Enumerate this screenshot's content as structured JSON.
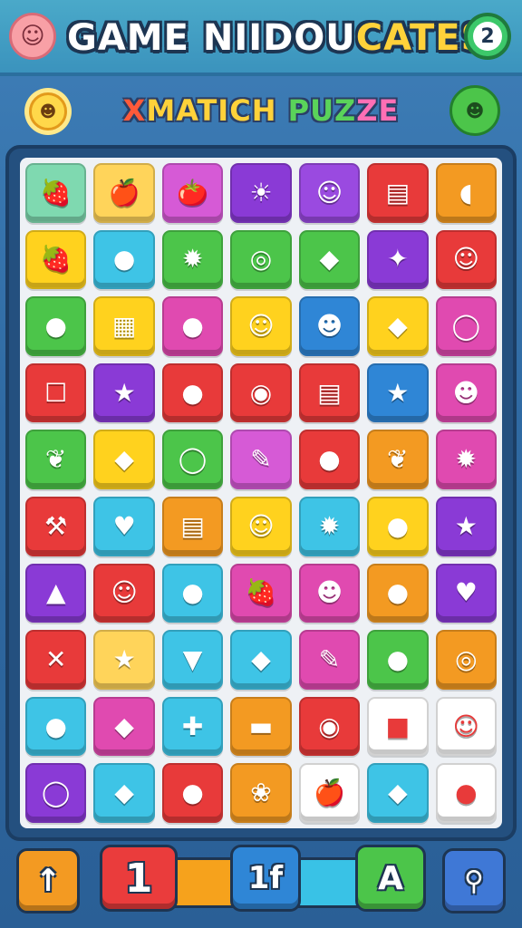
{
  "header": {
    "title_main": "GAME NIIDOU",
    "title_accent": "CATES",
    "level": "2",
    "mascot_icon": "pig-face-icon"
  },
  "subtitle": {
    "parts": [
      "X",
      "MATICH ",
      "PUZ",
      "ZE"
    ],
    "left_icon": "sun-face-icon",
    "right_icon": "green-monster-icon"
  },
  "board": {
    "columns": 7,
    "rows": 10,
    "tiles": [
      {
        "color": "#7fd9b0",
        "icon": "strawberry-icon",
        "glyph": "🍓"
      },
      {
        "color": "#ffd45a",
        "icon": "apple-icon",
        "glyph": "🍎"
      },
      {
        "color": "#d65ad6",
        "icon": "red-fruit-icon",
        "glyph": "🍅"
      },
      {
        "color": "#8a3ad6",
        "icon": "sun-face-icon",
        "glyph": "☀"
      },
      {
        "color": "#9a4ae0",
        "icon": "face-icon",
        "glyph": "☺"
      },
      {
        "color": "#e83a3a",
        "icon": "slot-icon",
        "glyph": "▤"
      },
      {
        "color": "#f39a22",
        "icon": "banana-icon",
        "glyph": "◖"
      },
      {
        "color": "#ffd21e",
        "icon": "berry-face-icon",
        "glyph": "🍓"
      },
      {
        "color": "#3ec4e6",
        "icon": "blue-fruit-icon",
        "glyph": "●"
      },
      {
        "color": "#4cc54a",
        "icon": "green-monster-icon",
        "glyph": "✹"
      },
      {
        "color": "#4cc54a",
        "icon": "swirl-icon",
        "glyph": "◎"
      },
      {
        "color": "#4cc54a",
        "icon": "lemon-icon",
        "glyph": "◆"
      },
      {
        "color": "#8a3ad6",
        "icon": "purple-berry-icon",
        "glyph": "✦"
      },
      {
        "color": "#e83a3a",
        "icon": "cat-face-icon",
        "glyph": "☺"
      },
      {
        "color": "#4cc54a",
        "icon": "plum-icon",
        "glyph": "●"
      },
      {
        "color": "#ffd21e",
        "icon": "calculator-icon",
        "glyph": "▦"
      },
      {
        "color": "#e04ab0",
        "icon": "pink-apple-icon",
        "glyph": "●"
      },
      {
        "color": "#ffd21e",
        "icon": "cat-face-icon",
        "glyph": "☺"
      },
      {
        "color": "#2f86d6",
        "icon": "apple-face-icon",
        "glyph": "☻"
      },
      {
        "color": "#ffd21e",
        "icon": "lemon-icon",
        "glyph": "◆"
      },
      {
        "color": "#e04ab0",
        "icon": "ring-icon",
        "glyph": "◯"
      },
      {
        "color": "#e83a3a",
        "icon": "sugar-cube-icon",
        "glyph": "☐"
      },
      {
        "color": "#8a3ad6",
        "icon": "star-icon",
        "glyph": "★"
      },
      {
        "color": "#e83a3a",
        "icon": "green-apple-icon",
        "glyph": "●"
      },
      {
        "color": "#e83a3a",
        "icon": "mango-icon",
        "glyph": "◉"
      },
      {
        "color": "#e83a3a",
        "icon": "slot-icon",
        "glyph": "▤"
      },
      {
        "color": "#2f86d6",
        "icon": "star-icon",
        "glyph": "★"
      },
      {
        "color": "#e04ab0",
        "icon": "green-blob-icon",
        "glyph": "☻"
      },
      {
        "color": "#4cc54a",
        "icon": "carrot-icon",
        "glyph": "❦"
      },
      {
        "color": "#ffd21e",
        "icon": "gem-icon",
        "glyph": "◆"
      },
      {
        "color": "#4cc54a",
        "icon": "ring-icon",
        "glyph": "◯"
      },
      {
        "color": "#d65ad6",
        "icon": "pen-icon",
        "glyph": "✎"
      },
      {
        "color": "#e83a3a",
        "icon": "bomb-icon",
        "glyph": "●"
      },
      {
        "color": "#f39a22",
        "icon": "root-face-icon",
        "glyph": "❦"
      },
      {
        "color": "#e04ab0",
        "icon": "green-monster-icon",
        "glyph": "✹"
      },
      {
        "color": "#e83a3a",
        "icon": "pickaxe-icon",
        "glyph": "⚒"
      },
      {
        "color": "#3ec4e6",
        "icon": "heart-icon",
        "glyph": "♥"
      },
      {
        "color": "#f39a22",
        "icon": "slot-icon",
        "glyph": "▤"
      },
      {
        "color": "#ffd21e",
        "icon": "cat-face-icon",
        "glyph": "☺"
      },
      {
        "color": "#3ec4e6",
        "icon": "purple-blob-icon",
        "glyph": "✹"
      },
      {
        "color": "#ffd21e",
        "icon": "peach-icon",
        "glyph": "●"
      },
      {
        "color": "#8a3ad6",
        "icon": "star-icon",
        "glyph": "★"
      },
      {
        "color": "#8a3ad6",
        "icon": "pyramid-icon",
        "glyph": "▲"
      },
      {
        "color": "#e83a3a",
        "icon": "lion-face-icon",
        "glyph": "☺"
      },
      {
        "color": "#3ec4e6",
        "icon": "green-fruit-icon",
        "glyph": "●"
      },
      {
        "color": "#e04ab0",
        "icon": "strawberry-icon",
        "glyph": "🍓"
      },
      {
        "color": "#e04ab0",
        "icon": "yellow-blob-icon",
        "glyph": "☻"
      },
      {
        "color": "#f39a22",
        "icon": "green-apple-icon",
        "glyph": "●"
      },
      {
        "color": "#8a3ad6",
        "icon": "heart-shield-icon",
        "glyph": "♥"
      },
      {
        "color": "#e83a3a",
        "icon": "crossed-tools-icon",
        "glyph": "✕"
      },
      {
        "color": "#ffd45a",
        "icon": "star-icon",
        "glyph": "★"
      },
      {
        "color": "#3ec4e6",
        "icon": "brush-icon",
        "glyph": "▼"
      },
      {
        "color": "#3ec4e6",
        "icon": "lemon-icon",
        "glyph": "◆"
      },
      {
        "color": "#e04ab0",
        "icon": "pencil-icon",
        "glyph": "✎"
      },
      {
        "color": "#4cc54a",
        "icon": "pear-icon",
        "glyph": "●"
      },
      {
        "color": "#f39a22",
        "icon": "target-icon",
        "glyph": "◎"
      },
      {
        "color": "#3ec4e6",
        "icon": "plum-icon",
        "glyph": "●"
      },
      {
        "color": "#e04ab0",
        "icon": "green-leaf-icon",
        "glyph": "◆"
      },
      {
        "color": "#3ec4e6",
        "icon": "cross-icon",
        "glyph": "✚"
      },
      {
        "color": "#f39a22",
        "icon": "corn-icon",
        "glyph": "▬"
      },
      {
        "color": "#e83a3a",
        "icon": "chili-icon",
        "glyph": "◉"
      },
      {
        "color": "#ffffff",
        "icon": "red-cube-icon",
        "glyph": "■"
      },
      {
        "color": "#ffffff",
        "icon": "cat-face-icon",
        "glyph": "☺"
      },
      {
        "color": "#8a3ad6",
        "icon": "ring-icon",
        "glyph": "◯"
      },
      {
        "color": "#3ec4e6",
        "icon": "fish-icon",
        "glyph": "◆"
      },
      {
        "color": "#e83a3a",
        "icon": "pink-fruit-icon",
        "glyph": "●"
      },
      {
        "color": "#f39a22",
        "icon": "candy-icon",
        "glyph": "❀"
      },
      {
        "color": "#ffffff",
        "icon": "apple-icon",
        "glyph": "🍎"
      },
      {
        "color": "#3ec4e6",
        "icon": "gem-icon",
        "glyph": "◆"
      },
      {
        "color": "#ffffff",
        "icon": "green-drop-icon",
        "glyph": "●"
      }
    ]
  },
  "toolbar": {
    "up_label": "↑",
    "one_label": "1",
    "mid_label": "1f",
    "a_label": "A",
    "key_icon": "magnifier-icon",
    "key_label": "⚲"
  }
}
